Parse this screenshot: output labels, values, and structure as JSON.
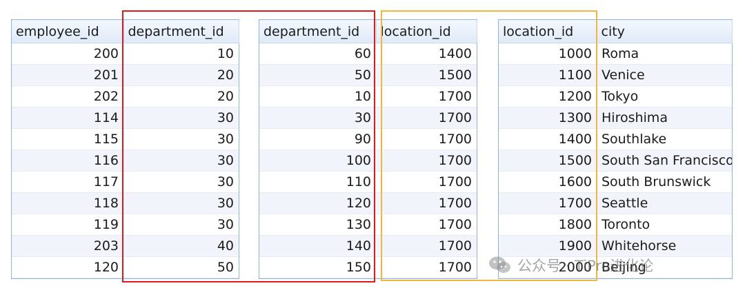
{
  "tables": [
    {
      "name": "employees-grid",
      "columns": [
        "employee_id",
        "department_id"
      ],
      "rows": [
        [
          "200",
          "10"
        ],
        [
          "201",
          "20"
        ],
        [
          "202",
          "20"
        ],
        [
          "114",
          "30"
        ],
        [
          "115",
          "30"
        ],
        [
          "116",
          "30"
        ],
        [
          "117",
          "30"
        ],
        [
          "118",
          "30"
        ],
        [
          "119",
          "30"
        ],
        [
          "203",
          "40"
        ],
        [
          "120",
          "50"
        ]
      ]
    },
    {
      "name": "departments-grid",
      "columns": [
        "department_id",
        "location_id"
      ],
      "rows": [
        [
          "60",
          "1400"
        ],
        [
          "50",
          "1500"
        ],
        [
          "10",
          "1700"
        ],
        [
          "30",
          "1700"
        ],
        [
          "90",
          "1700"
        ],
        [
          "100",
          "1700"
        ],
        [
          "110",
          "1700"
        ],
        [
          "120",
          "1700"
        ],
        [
          "130",
          "1700"
        ],
        [
          "140",
          "1700"
        ],
        [
          "150",
          "1700"
        ]
      ]
    },
    {
      "name": "locations-grid",
      "columns": [
        "location_id",
        "city"
      ],
      "rows": [
        [
          "1000",
          "Roma"
        ],
        [
          "1100",
          "Venice"
        ],
        [
          "1200",
          "Tokyo"
        ],
        [
          "1300",
          "Hiroshima"
        ],
        [
          "1400",
          "Southlake"
        ],
        [
          "1500",
          "South San Francisco"
        ],
        [
          "1600",
          "South Brunswick"
        ],
        [
          "1700",
          "Seattle"
        ],
        [
          "1800",
          "Toronto"
        ],
        [
          "1900",
          "Whitehorse"
        ],
        [
          "2000",
          "Beijing"
        ]
      ]
    }
  ],
  "highlights": {
    "red_color": "#e5171d",
    "yellow_color": "#f2b63a"
  },
  "watermark": {
    "text": "公众号 · TiPro进化论",
    "icon": "wechat-icon"
  }
}
